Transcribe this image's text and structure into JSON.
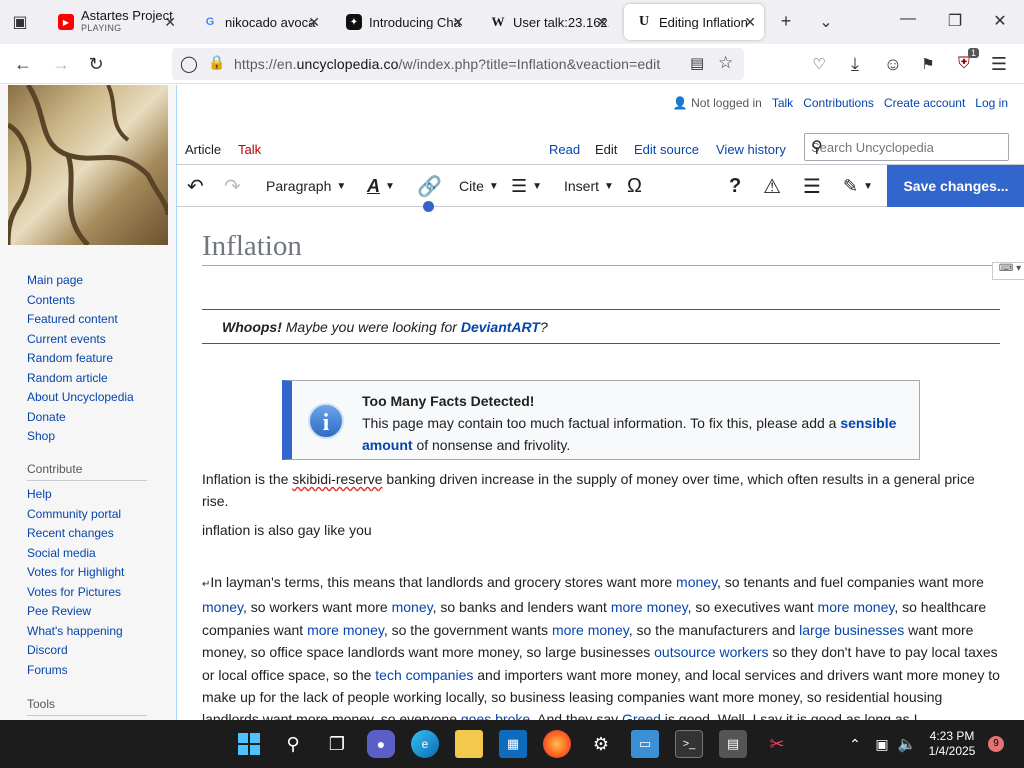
{
  "browser": {
    "tabs": [
      {
        "title": "Astartes Project",
        "subtitle": "PLAYING",
        "favicon": "youtube-icon"
      },
      {
        "title": "nikocado avoca",
        "favicon": "google-icon"
      },
      {
        "title": "Introducing Cha",
        "favicon": "openai-icon"
      },
      {
        "title": "User talk:23.162.",
        "favicon": "wikipedia-icon"
      },
      {
        "title": "Editing Inflation",
        "favicon": "uncyclopedia-icon"
      }
    ],
    "url_prefix": "https://en.",
    "url_domain": "uncyclopedia.co",
    "url_rest": "/w/index.php?title=Inflation&veaction=edit",
    "extension_badge": "1"
  },
  "sidebar": {
    "nav_items": [
      "Main page",
      "Contents",
      "Featured content",
      "Current events",
      "Random feature",
      "Random article",
      "About Uncyclopedia",
      "Donate",
      "Shop"
    ],
    "contribute_heading": "Contribute",
    "contribute_items": [
      "Help",
      "Community portal",
      "Recent changes",
      "Social media",
      "Votes for Highlight",
      "Votes for Pictures",
      "Pee Review",
      "What's happening",
      "Discord",
      "Forums"
    ],
    "tools_heading": "Tools"
  },
  "user_tools": {
    "not_logged_in": "Not logged in",
    "talk": "Talk",
    "contributions": "Contributions",
    "create_account": "Create account",
    "login": "Log in"
  },
  "namespaces": {
    "article": "Article",
    "talk": "Talk"
  },
  "views": {
    "read": "Read",
    "edit": "Edit",
    "edit_source": "Edit source",
    "view_history": "View history"
  },
  "search": {
    "placeholder": "Search Uncyclopedia"
  },
  "toolbar": {
    "paragraph": "Paragraph",
    "cite": "Cite",
    "insert": "Insert",
    "save": "Save changes..."
  },
  "article": {
    "title": "Inflation",
    "hatnote_bold": "Whoops!",
    "hatnote_text": "Maybe you were looking for",
    "hatnote_link": "DeviantART",
    "hatnote_end": "?",
    "ambox_title": "Too Many Facts Detected!",
    "ambox_text": "This page may contain too much factual information. To fix this, please add a",
    "ambox_link": "sensible amount",
    "ambox_end": "of nonsense and frivolity.",
    "p1_a": "Inflation is the ",
    "p1_misspelled": "skibidi-reserve",
    "p1_b": " banking driven increase in the supply of money over time, which often results in a general price rise.",
    "p2": "inflation is also gay like you",
    "p3": [
      {
        "t": "In layman's terms, this means that landlords and grocery stores want more "
      },
      {
        "t": "money",
        "link": true
      },
      {
        "t": ", so tenants and fuel companies want more "
      },
      {
        "t": "money",
        "link": true
      },
      {
        "t": ", so workers want more "
      },
      {
        "t": "money",
        "link": true
      },
      {
        "t": ", so banks and lenders want "
      },
      {
        "t": "more money",
        "link": true
      },
      {
        "t": ", so executives want "
      },
      {
        "t": "more money",
        "link": true
      },
      {
        "t": ", so healthcare companies want "
      },
      {
        "t": "more money",
        "link": true
      },
      {
        "t": ", so the government wants "
      },
      {
        "t": "more money",
        "link": true
      },
      {
        "t": ", so the manufacturers and "
      },
      {
        "t": "large businesses",
        "link": true
      },
      {
        "t": " want more money, so office space landlords want more money, so large businesses "
      },
      {
        "t": "outsource workers",
        "link": true
      },
      {
        "t": " so they don't have to pay local taxes or local office space, so the "
      },
      {
        "t": "tech companies",
        "link": true
      },
      {
        "t": " and importers want more money, and local services and drivers want more money to make up for the lack of people working locally, so business leasing companies want more money, so residential housing landlords want more money, so everyone "
      },
      {
        "t": "goes broke",
        "link": true
      },
      {
        "t": ". And they say "
      },
      {
        "t": "Greed",
        "link": true
      },
      {
        "t": " is good. Well, I say it is good as long as I"
      }
    ]
  },
  "taskbar": {
    "time": "4:23 PM",
    "date": "1/4/2025",
    "notifications": "9"
  },
  "colors": {
    "link": "#0645ad",
    "accent": "#3366cc",
    "talk_red": "#ba0000"
  }
}
